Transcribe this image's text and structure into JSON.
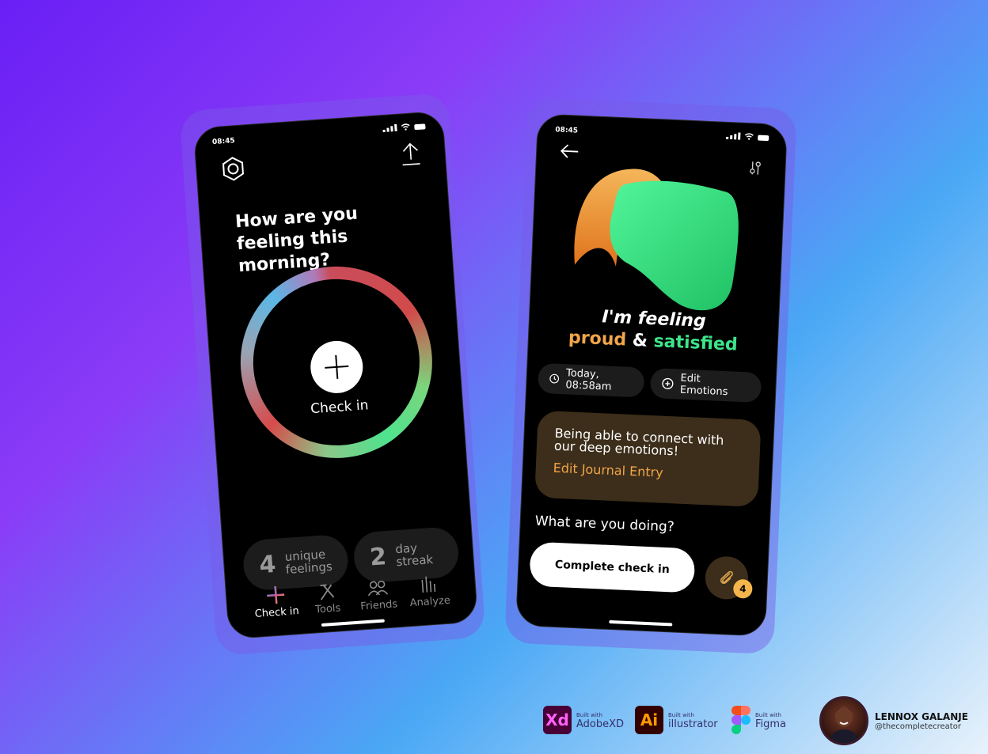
{
  "phone1": {
    "time": "08:45",
    "title": "How are you feeling this morning?",
    "checkin_label": "Check in",
    "stats": [
      {
        "num": "4",
        "label": "unique feelings"
      },
      {
        "num": "2",
        "label": "day streak"
      }
    ],
    "nav": [
      {
        "label": "Check in",
        "icon": "plus-gradient-icon"
      },
      {
        "label": "Tools",
        "icon": "tools-icon"
      },
      {
        "label": "Friends",
        "icon": "friends-icon"
      },
      {
        "label": "Analyze",
        "icon": "analyze-icon"
      }
    ]
  },
  "phone2": {
    "time": "08:45",
    "feeling_line1": "I'm feeling",
    "feeling_word1": "proud",
    "feeling_amp": "&",
    "feeling_word2": "satisfied",
    "time_chip": "Today, 08:58am",
    "edit_emotions": "Edit Emotions",
    "journal_text": "Being able to connect with our deep emotions!",
    "journal_link": "Edit Journal Entry",
    "doing_question": "What are you doing?",
    "complete_button": "Complete check in",
    "attachment_count": "4"
  },
  "footer": {
    "tools": [
      {
        "logo": "Xd",
        "small": "Built with",
        "name": "AdobeXD"
      },
      {
        "logo": "Ai",
        "small": "Built with",
        "name": "illustrator"
      },
      {
        "logo": "",
        "small": "Built with",
        "name": "Figma"
      }
    ],
    "author_name": "LENNOX GALANJE",
    "author_handle": "@thecompletecreator"
  },
  "colors": {
    "accent_orange": "#f2a54a",
    "accent_green": "#3de58a",
    "journal_bg": "#3c2e1a",
    "xd_bg": "#470137",
    "ai_bg": "#330000"
  }
}
